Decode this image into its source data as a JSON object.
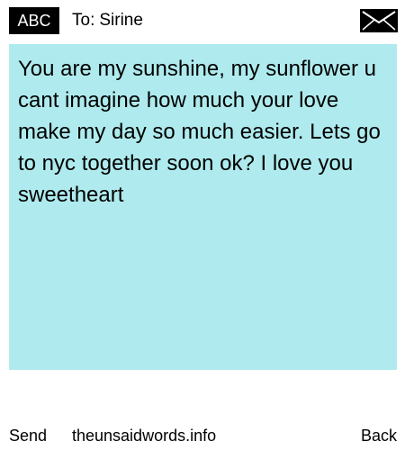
{
  "header": {
    "mode_badge": "ABC",
    "to_label": "To:",
    "recipient": "Sirine",
    "envelope_icon": "envelope-icon"
  },
  "message": {
    "body": "You are my sunshine, my sunflower u cant imagine how much your love make my day so much easier. Lets go to nyc together soon ok? I love you sweetheart",
    "background_color": "#afebee"
  },
  "footer": {
    "send_label": "Send",
    "site": "theunsaidwords.info",
    "back_label": "Back"
  }
}
